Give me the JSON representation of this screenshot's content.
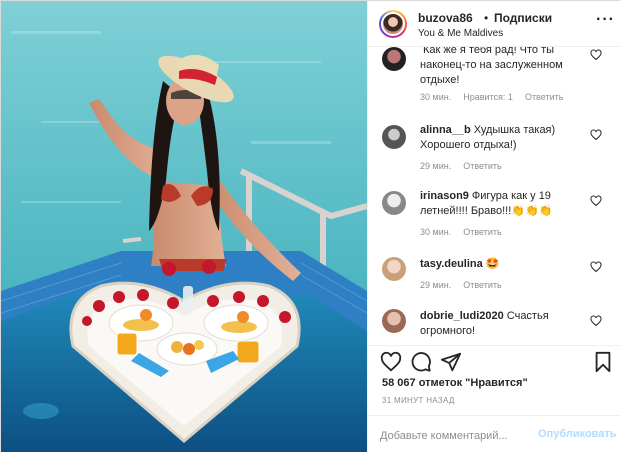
{
  "header": {
    "username": "buzova86",
    "dot": "•",
    "follow_label": "Подписки",
    "location": "You & Me Maldives",
    "more_icon": "more-horizontal-icon"
  },
  "comments": [
    {
      "username": "",
      "text": "Как же я тебя рад! Что ты наконец-то на заслуженном отдыхе!",
      "time": "30 мин.",
      "likes": "Нравится: 1",
      "reply": "Ответить"
    },
    {
      "username": "alinna__b",
      "text": "Худышка такая) Хорошего отдыха!)",
      "time": "29 мин.",
      "reply": "Ответить"
    },
    {
      "username": "irinason9",
      "text": "Фигура как у 19 летней!!!! Браво!!!👏👏👏",
      "time": "30 мин.",
      "reply": "Ответить"
    },
    {
      "username": "tasy.deulina",
      "text": "🤩",
      "time": "29 мин.",
      "reply": "Ответить"
    },
    {
      "username": "dobrie_ludi2020",
      "text": "Счастья огромного!",
      "time": "",
      "reply": ""
    }
  ],
  "actions": {
    "like_icon": "heart-icon",
    "comment_icon": "comment-icon",
    "share_icon": "paper-plane-icon",
    "save_icon": "bookmark-icon"
  },
  "likes_text": "58 067 отметок \"Нравится\"",
  "posted_time": "31 МИНУТ НАЗАД",
  "add_comment": {
    "placeholder": "Добавьте комментарий...",
    "submit_label": "Опубликовать"
  },
  "colors": {
    "link_disabled": "#b3dbff",
    "meta_gray": "#8e8e8e",
    "text": "#262626"
  }
}
